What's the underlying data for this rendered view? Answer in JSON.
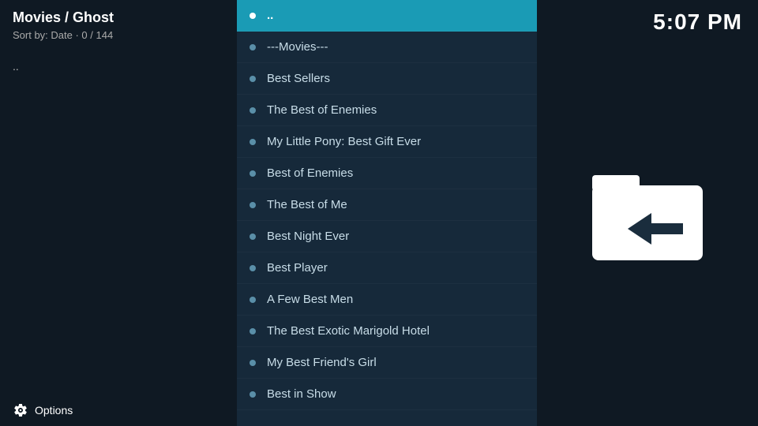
{
  "header": {
    "title": "Movies / Ghost",
    "sort_info": "Sort by: Date  ·  0 / 144",
    "clock": "5:07 PM"
  },
  "sidebar": {
    "parent_link": "..",
    "options_label": "Options"
  },
  "list": {
    "items": [
      {
        "id": "parent-nav",
        "label": "..",
        "selected": true
      },
      {
        "id": "movies-header",
        "label": "---Movies---",
        "selected": false
      },
      {
        "id": "best-sellers",
        "label": "Best Sellers",
        "selected": false
      },
      {
        "id": "the-best-of-enemies",
        "label": "The Best of Enemies",
        "selected": false
      },
      {
        "id": "my-little-pony",
        "label": "My Little Pony: Best Gift Ever",
        "selected": false
      },
      {
        "id": "best-of-enemies",
        "label": "Best of Enemies",
        "selected": false
      },
      {
        "id": "the-best-of-me",
        "label": "The Best of Me",
        "selected": false
      },
      {
        "id": "best-night-ever",
        "label": "Best Night Ever",
        "selected": false
      },
      {
        "id": "best-player",
        "label": "Best Player",
        "selected": false
      },
      {
        "id": "a-few-best-men",
        "label": "A Few Best Men",
        "selected": false
      },
      {
        "id": "the-best-exotic-marigold-hotel",
        "label": "The Best Exotic Marigold Hotel",
        "selected": false
      },
      {
        "id": "my-best-friends-girl",
        "label": "My Best Friend's Girl",
        "selected": false
      },
      {
        "id": "best-in-show",
        "label": "Best in Show",
        "selected": false
      }
    ]
  }
}
